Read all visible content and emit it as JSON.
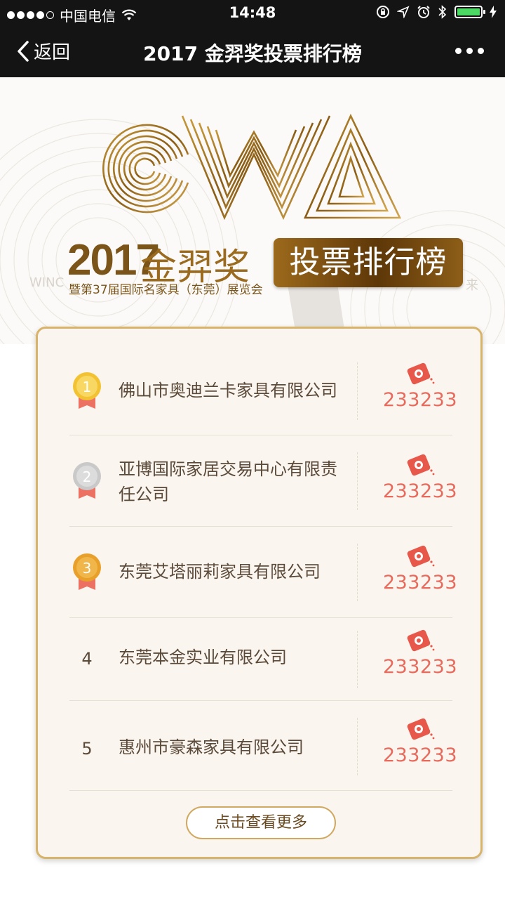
{
  "status_bar": {
    "carrier": "中国电信",
    "time": "14:48"
  },
  "nav": {
    "back_label": "返回",
    "title": "2017 金羿奖投票排行榜"
  },
  "banner": {
    "year": "2017",
    "award": "金羿奖",
    "subtitle": "暨第37届国际名家具（东莞）展览会",
    "ranking_label": "投票排行榜",
    "faded_left": "WINC",
    "faded_right": "来"
  },
  "ranking": {
    "items": [
      {
        "rank": "1",
        "name": "佛山市奥迪兰卡家具有限公司",
        "votes": "233233",
        "medal": "gold"
      },
      {
        "rank": "2",
        "name": "亚博国际家居交易中心有限责任公司",
        "votes": "233233",
        "medal": "silver"
      },
      {
        "rank": "3",
        "name": "东莞艾塔丽莉家具有限公司",
        "votes": "233233",
        "medal": "bronze"
      },
      {
        "rank": "4",
        "name": "东莞本金实业有限公司",
        "votes": "233233",
        "medal": ""
      },
      {
        "rank": "5",
        "name": "惠州市豪森家具有限公司",
        "votes": "233233",
        "medal": ""
      }
    ],
    "more_label": "点击查看更多"
  },
  "colors": {
    "gold_medal": "#f2c233",
    "silver_medal": "#c9c9c9",
    "bronze_medal": "#e9a02a",
    "ribbon": "#ec7163",
    "vote_accent": "#e86a5c",
    "card_border": "#d8b36a"
  },
  "icons": {
    "back": "chevron-left-icon",
    "more": "more-dots-icon",
    "vote": "vote-ticket-icon"
  }
}
